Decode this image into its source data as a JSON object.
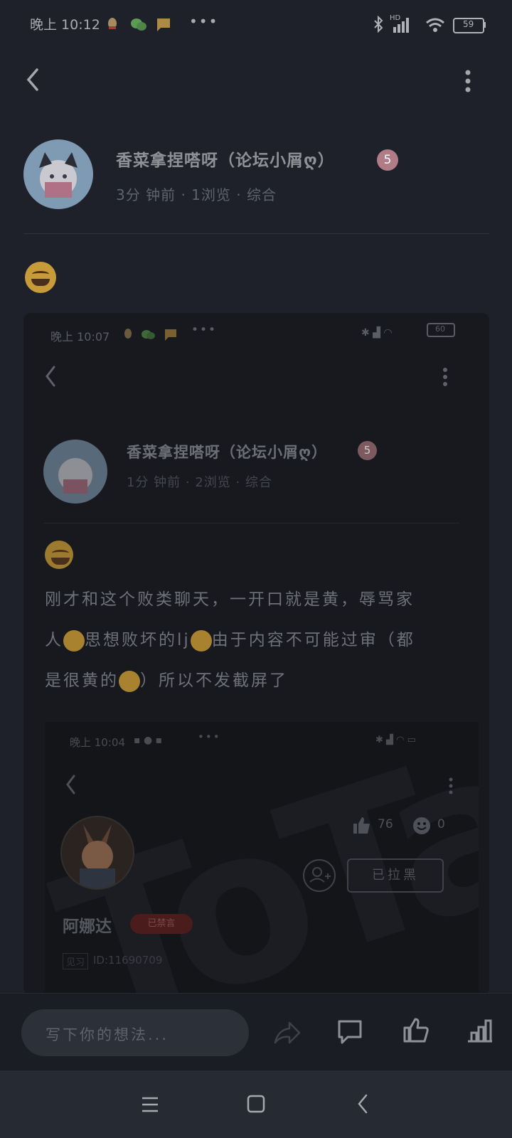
{
  "status_bar": {
    "time": "晚上 10:12",
    "network": "HD",
    "battery": "59"
  },
  "post": {
    "author": "香菜拿捏嗒呀（论坛小屑ღ）",
    "level": "5",
    "meta": "3分 钟前 · 1浏览 · 综合"
  },
  "embedded_screenshot": {
    "time": "晚上 10:07",
    "battery": "60",
    "author": "香菜拿捏嗒呀（论坛小屑ღ）",
    "level": "5",
    "meta": "1分 钟前 · 2浏览 · 综合",
    "text_line1": "刚才和这个败类聊天，一开口就是黄，辱骂家",
    "text_line2_a": "人",
    "text_line2_b": "思想败坏的lj",
    "text_line2_c": "由于内容不可能过审（都",
    "text_line3_a": "是很黄的",
    "text_line3_b": "）所以不发截屏了",
    "nested": {
      "time": "晚上 10:04",
      "likes": "76",
      "emoji_count": "0",
      "blocked_label": "已拉黑",
      "user_name": "阿娜达",
      "muted_badge": "已禁言",
      "user_id": "ID:11690709",
      "rank_tag": "见习"
    }
  },
  "comment_input": {
    "placeholder": "写下你的想法..."
  }
}
